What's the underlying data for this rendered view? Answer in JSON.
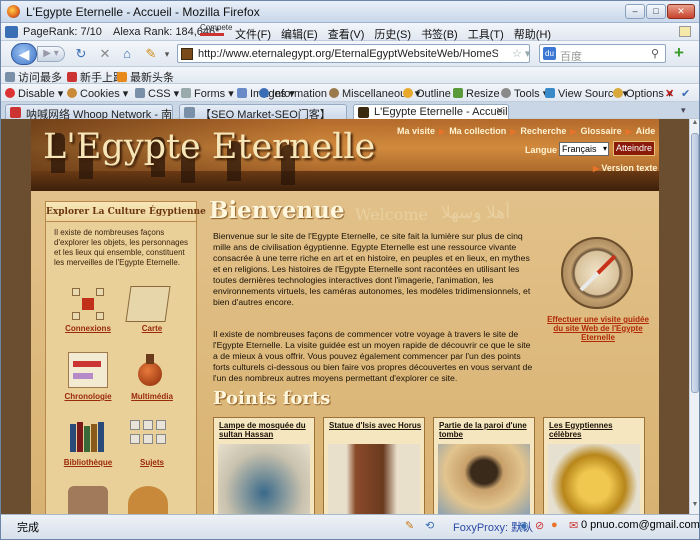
{
  "browser": {
    "title": "L'Egypte Eternelle - Accueil - Mozilla Firefox",
    "pagerank": "PageRank: 7/10",
    "alexa": "Alexa Rank: 184,646*",
    "compete": "Compete",
    "menus": [
      "文件(F)",
      "编辑(E)",
      "查看(V)",
      "历史(S)",
      "书签(B)",
      "工具(T)",
      "帮助(H)"
    ],
    "url": "http://www.eternalegypt.org/EternalEgyptWebsiteWeb/HomeServlet?ee_website_",
    "search_placeholder": "百度",
    "search_engine": "du",
    "bookmarks": [
      "访问最多",
      "新手上路",
      "最新头条"
    ],
    "webdev": [
      "Disable",
      "Cookies",
      "CSS",
      "Forms",
      "Images",
      "Information",
      "Miscellaneous",
      "Outline",
      "Resize",
      "Tools",
      "View Source",
      "Options"
    ],
    "tabs": [
      "呐喊网络 Whoop Network - 南你...",
      "【SEO Market-SEO门客】",
      "L'Egypte Eternelle - Accueil"
    ],
    "status": "完成",
    "foxyproxy": "FoxyProxy: 默认",
    "mail": "0 pnuo.com@gmail.com"
  },
  "site": {
    "logo": "L'Egypte Eternelle",
    "toplinks": [
      "Ma visite",
      "Ma collection",
      "Recherche",
      "Glossaire",
      "Aide"
    ],
    "lang_label": "Langue :",
    "lang_value": "Français",
    "lang_button": "Atteindre",
    "version_texte": "Version texte",
    "sidebar": {
      "heading": "Explorer La Culture Égyptienne",
      "intro": "Il existe de nombreuses façons d'explorer les objets, les personnages et les lieux qui ensemble, constituent les merveilles de l'Egypte Eternelle.",
      "items": [
        "Connexions",
        "Carte",
        "Chronologie",
        "Multimédia",
        "Bibliothèque",
        "Sujets"
      ]
    },
    "welcome_title": "Bienvenue",
    "welcome_en": "Welcome",
    "welcome_ar": "أهلا وسهلا",
    "para1": "Bienvenue sur le site de l'Egypte Eternelle, ce site fait la lumière sur plus de cinq mille ans de civilisation égyptienne. Egypte Eternelle est une ressource vivante consacrée à une terre riche en art et en histoire, en peuples et en lieux, en mythes et en religions. Les histoires de l'Egypte Eternelle sont racontées en utilisant les toutes dernières technologies interactives dont l'imagerie, l'animation, les environnements virtuels, les caméras autonomes, les modèles tridimensionnels, et bien d'autres encore.",
    "para2": "Il existe de nombreuses façons de commencer votre voyage à travers le site de l'Egypte Eternelle. La visite guidée est un moyen rapide de découvrir ce que le site a de mieux à vous offrir. Vous pouvez également commencer par l'un des points forts culturels ci-dessous ou bien faire vos propres découvertes en vous servant de l'un des nombreux autres moyens permettant d'explorer ce site.",
    "tour_link": "Effectuer une visite guidée du site Web de l'Egypte Eternelle",
    "highlights_title": "Points forts",
    "highlights": [
      "Lampe de mosquée du sultan Hassan",
      "Statue d'Isis avec Horus",
      "Partie de la paroi d'une tombe",
      "Les Egyptiennes célèbres"
    ]
  }
}
